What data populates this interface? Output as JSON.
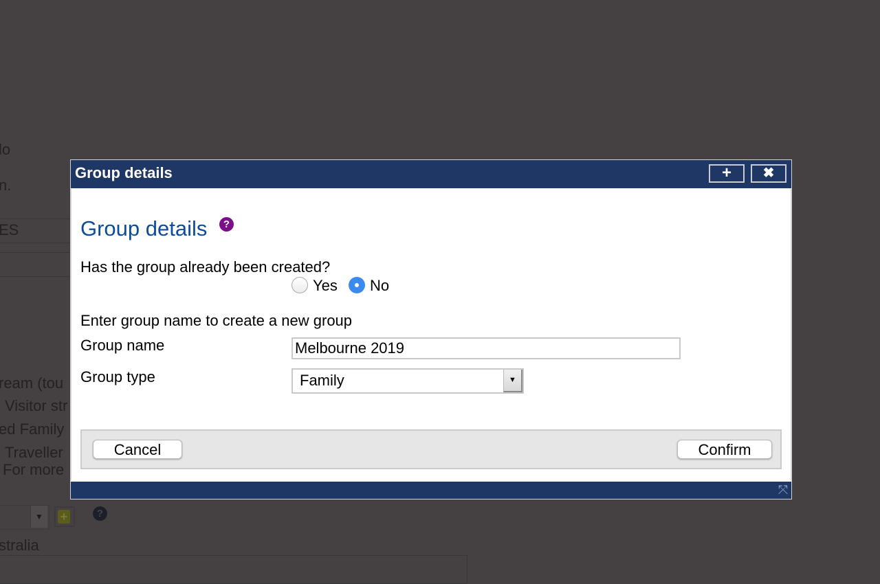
{
  "background": {
    "fragments": [
      "lo",
      "n.",
      "ES",
      "ream (tou",
      "Visitor str",
      "ed Family",
      "Traveller",
      "For more",
      "stralia"
    ],
    "icons": [
      "dropdown-arrow-icon",
      "add-icon",
      "help-icon"
    ]
  },
  "dialog": {
    "title": "Group details",
    "titlebar_buttons": {
      "maximize_icon": "+",
      "close_icon": "✖"
    },
    "heading": "Group details",
    "help_icon": "?",
    "question": "Has the group already been created?",
    "radio_options": [
      {
        "label": "Yes",
        "selected": false
      },
      {
        "label": "No",
        "selected": true
      }
    ],
    "instruction": "Enter group name to create a new group",
    "fields": {
      "group_name": {
        "label": "Group name",
        "value": "Melbourne 2019"
      },
      "group_type": {
        "label": "Group type",
        "value": "Family",
        "arrow": "▼"
      }
    },
    "buttons": {
      "cancel": "Cancel",
      "confirm": "Confirm"
    },
    "resize_icon": "⤧"
  },
  "colors": {
    "titlebar": "#1e3764",
    "heading": "#0e4c9a",
    "help_icon": "#7a0f8a",
    "radio_selected": "#3b8af0",
    "overlay": "#454142"
  }
}
